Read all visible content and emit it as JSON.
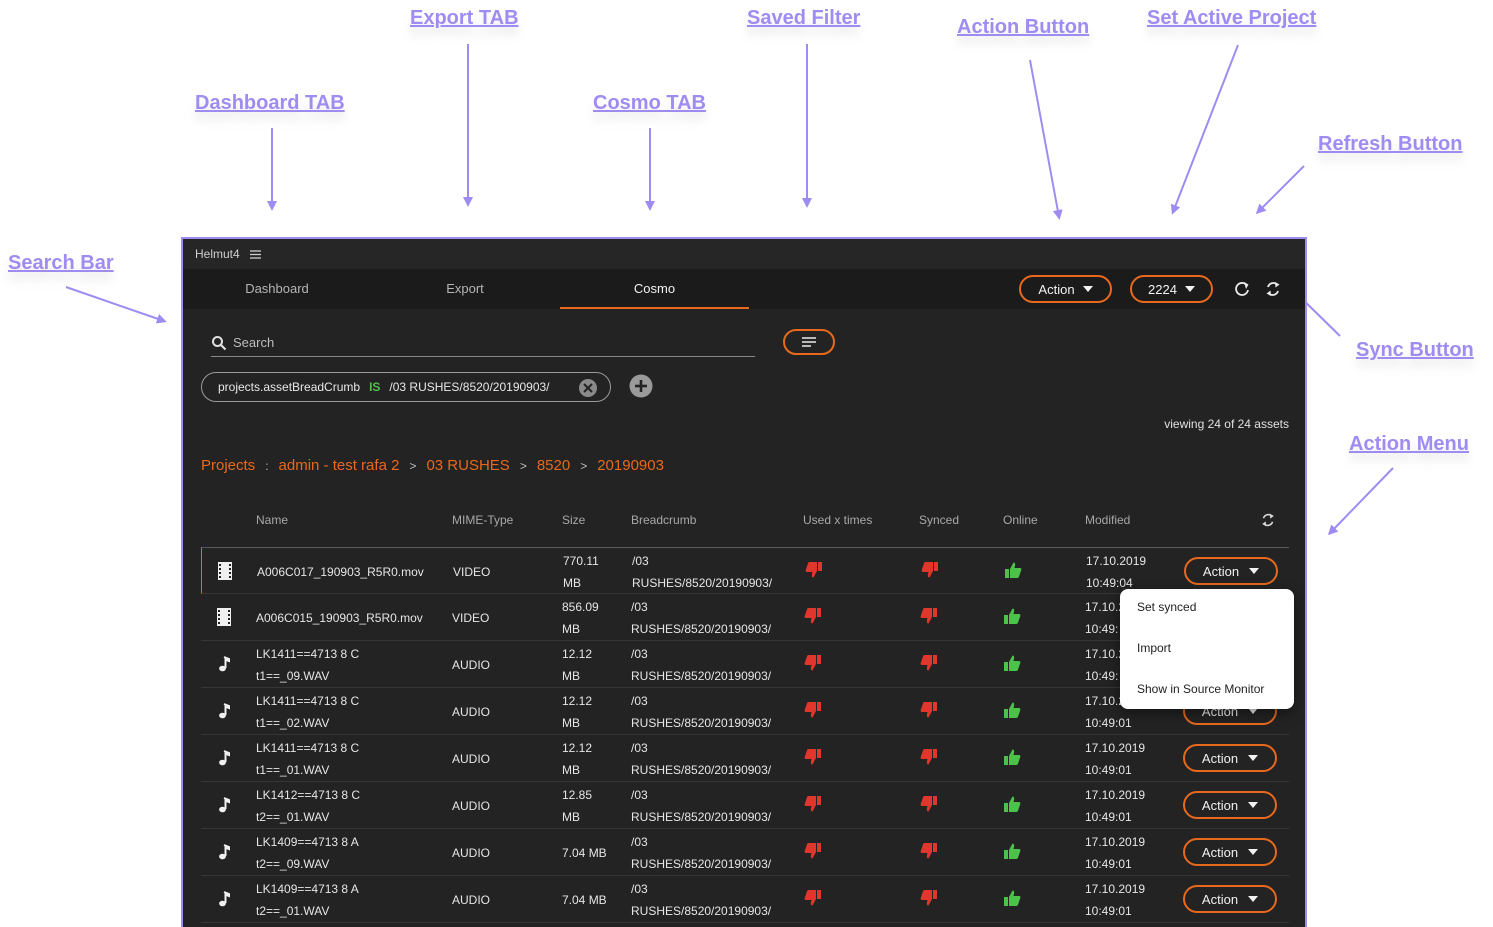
{
  "annotations": {
    "export_tab": "Export TAB",
    "saved_filter": "Saved Filter",
    "action_button": "Action Button",
    "set_active_project": "Set Active Project",
    "dashboard_tab": "Dashboard TAB",
    "cosmo_tab": "Cosmo TAB",
    "refresh_button": "Refresh Button",
    "search_bar": "Search Bar",
    "sync_button": "Sync Button",
    "action_menu": "Action Menu"
  },
  "colors": {
    "accent": "#e8691e",
    "annotation": "#9f8cf2",
    "thumbs_down": "#e0362c",
    "thumbs_up": "#4cc24a"
  },
  "app": {
    "title": "Helmut4",
    "menu_icon": "hamburger-icon"
  },
  "tabs": [
    {
      "label": "Dashboard"
    },
    {
      "label": "Export"
    },
    {
      "label": "Cosmo",
      "active": true
    }
  ],
  "header": {
    "action_label": "Action",
    "project_label": "2224",
    "refresh_icon": "refresh-icon",
    "sync_icon": "sync-icon"
  },
  "search": {
    "placeholder": "Search"
  },
  "filter": {
    "field": "projects.assetBreadCrumb",
    "operator": "IS",
    "value": "/03 RUSHES/8520/20190903/"
  },
  "viewing": "viewing 24 of 24 assets",
  "breadcrumb": {
    "root": "Projects",
    "separator": ":",
    "items": [
      "admin - test rafa 2",
      "03 RUSHES",
      "8520",
      "20190903"
    ],
    "arrow": ">"
  },
  "columns": [
    "Name",
    "MIME-Type",
    "Size",
    "Breadcrumb",
    "Used x times",
    "Synced",
    "Online",
    "Modified"
  ],
  "rows": [
    {
      "icon": "film-icon",
      "name1": "A006C017_190903_R5R0.mov",
      "name2": "",
      "mime": "VIDEO",
      "size1": "770.11",
      "size2": "MB",
      "crumb1": "/03",
      "crumb2": "RUSHES/8520/20190903/",
      "used": "thumbs-down",
      "synced": "thumbs-down",
      "online": "thumbs-up",
      "mod1": "17.10.2019",
      "mod2": "10:49:04",
      "action": "Action"
    },
    {
      "icon": "film-icon",
      "name1": "A006C015_190903_R5R0.mov",
      "name2": "",
      "mime": "VIDEO",
      "size1": "856.09",
      "size2": "MB",
      "crumb1": "/03",
      "crumb2": "RUSHES/8520/20190903/",
      "used": "thumbs-down",
      "synced": "thumbs-down",
      "online": "thumbs-up",
      "mod1": "17.10.2",
      "mod2": "10:49:",
      "action": ""
    },
    {
      "icon": "music-note-icon",
      "name1": "LK1411==4713 8 C",
      "name2": "t1==_09.WAV",
      "mime": "AUDIO",
      "size1": "12.12",
      "size2": "MB",
      "crumb1": "/03",
      "crumb2": "RUSHES/8520/20190903/",
      "used": "thumbs-down",
      "synced": "thumbs-down",
      "online": "thumbs-up",
      "mod1": "17.10.2",
      "mod2": "10:49:",
      "action": ""
    },
    {
      "icon": "music-note-icon",
      "name1": "LK1411==4713 8 C",
      "name2": "t1==_02.WAV",
      "mime": "AUDIO",
      "size1": "12.12",
      "size2": "MB",
      "crumb1": "/03",
      "crumb2": "RUSHES/8520/20190903/",
      "used": "thumbs-down",
      "synced": "thumbs-down",
      "online": "thumbs-up",
      "mod1": "17.10.2",
      "mod2": "10:49:01",
      "action": "Action"
    },
    {
      "icon": "music-note-icon",
      "name1": "LK1411==4713 8 C",
      "name2": "t1==_01.WAV",
      "mime": "AUDIO",
      "size1": "12.12",
      "size2": "MB",
      "crumb1": "/03",
      "crumb2": "RUSHES/8520/20190903/",
      "used": "thumbs-down",
      "synced": "thumbs-down",
      "online": "thumbs-up",
      "mod1": "17.10.2019",
      "mod2": "10:49:01",
      "action": "Action"
    },
    {
      "icon": "music-note-icon",
      "name1": "LK1412==4713 8 C",
      "name2": "t2==_01.WAV",
      "mime": "AUDIO",
      "size1": "12.85",
      "size2": "MB",
      "crumb1": "/03",
      "crumb2": "RUSHES/8520/20190903/",
      "used": "thumbs-down",
      "synced": "thumbs-down",
      "online": "thumbs-up",
      "mod1": "17.10.2019",
      "mod2": "10:49:01",
      "action": "Action"
    },
    {
      "icon": "music-note-icon",
      "name1": "LK1409==4713 8 A",
      "name2": "t2==_09.WAV",
      "mime": "AUDIO",
      "size1": "7.04 MB",
      "size2": "",
      "crumb1": "/03",
      "crumb2": "RUSHES/8520/20190903/",
      "used": "thumbs-down",
      "synced": "thumbs-down",
      "online": "thumbs-up",
      "mod1": "17.10.2019",
      "mod2": "10:49:01",
      "action": "Action"
    },
    {
      "icon": "music-note-icon",
      "name1": "LK1409==4713 8 A",
      "name2": "t2==_01.WAV",
      "mime": "AUDIO",
      "size1": "7.04 MB",
      "size2": "",
      "crumb1": "/03",
      "crumb2": "RUSHES/8520/20190903/",
      "used": "thumbs-down",
      "synced": "thumbs-down",
      "online": "thumbs-up",
      "mod1": "17.10.2019",
      "mod2": "10:49:01",
      "action": "Action"
    }
  ],
  "action_menu": [
    "Set synced",
    "Import",
    "Show in Source Monitor"
  ]
}
